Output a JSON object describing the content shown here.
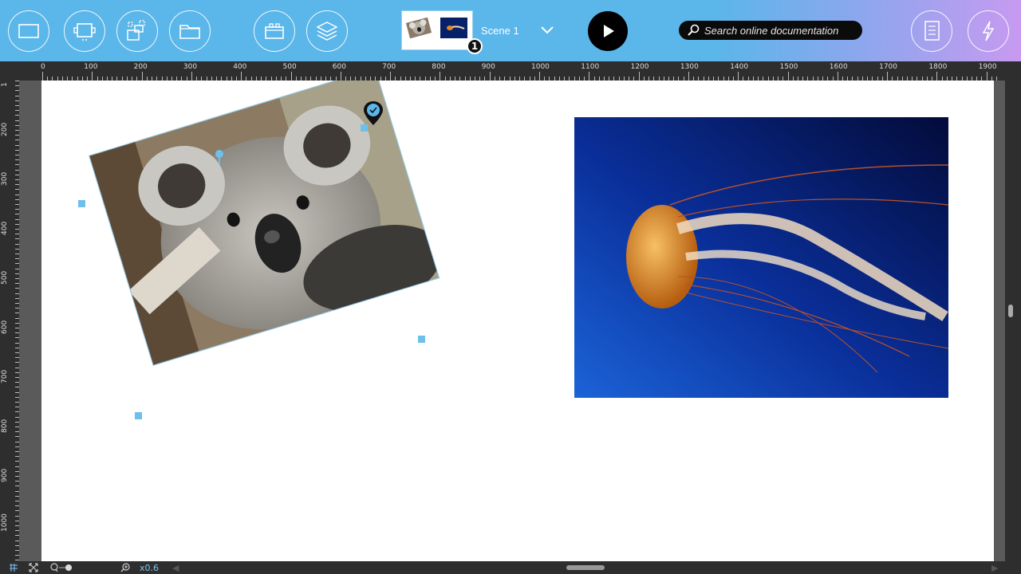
{
  "toolbar": {
    "buttons": [
      {
        "name": "add-rectangle-button",
        "icon": "rectangle-icon"
      },
      {
        "name": "add-device-button",
        "icon": "device-frame-icon"
      },
      {
        "name": "add-component-button",
        "icon": "component-icon"
      },
      {
        "name": "open-folder-button",
        "icon": "folder-icon"
      },
      {
        "name": "assets-button",
        "icon": "box-icon"
      },
      {
        "name": "layers-button",
        "icon": "layers-icon"
      }
    ],
    "scene": {
      "label": "Scene 1",
      "badge": "1"
    },
    "search": {
      "placeholder": "Search online documentation"
    },
    "right_buttons": [
      {
        "name": "checklist-button",
        "icon": "checklist-icon"
      },
      {
        "name": "actions-button",
        "icon": "lightning-icon"
      }
    ],
    "colors": {
      "bar_start": "#5bb6ea",
      "bar_end": "#c79af0"
    }
  },
  "ruler": {
    "top_labels": [
      "0",
      "100",
      "200",
      "300",
      "400",
      "500",
      "600",
      "700",
      "800",
      "900",
      "1000",
      "1100",
      "1200",
      "1300",
      "1400",
      "1500",
      "1600",
      "1700",
      "1800",
      "1900"
    ],
    "left_labels": [
      "1",
      "200",
      "300",
      "400",
      "500",
      "600",
      "700",
      "800",
      "900",
      "1000"
    ]
  },
  "canvas": {
    "images": [
      {
        "name": "koala-image",
        "subject": "koala",
        "rotation_deg": -17,
        "selected": true
      },
      {
        "name": "jellyfish-image",
        "subject": "jellyfish",
        "selected": false
      }
    ]
  },
  "status": {
    "zoom": "x0.6"
  }
}
